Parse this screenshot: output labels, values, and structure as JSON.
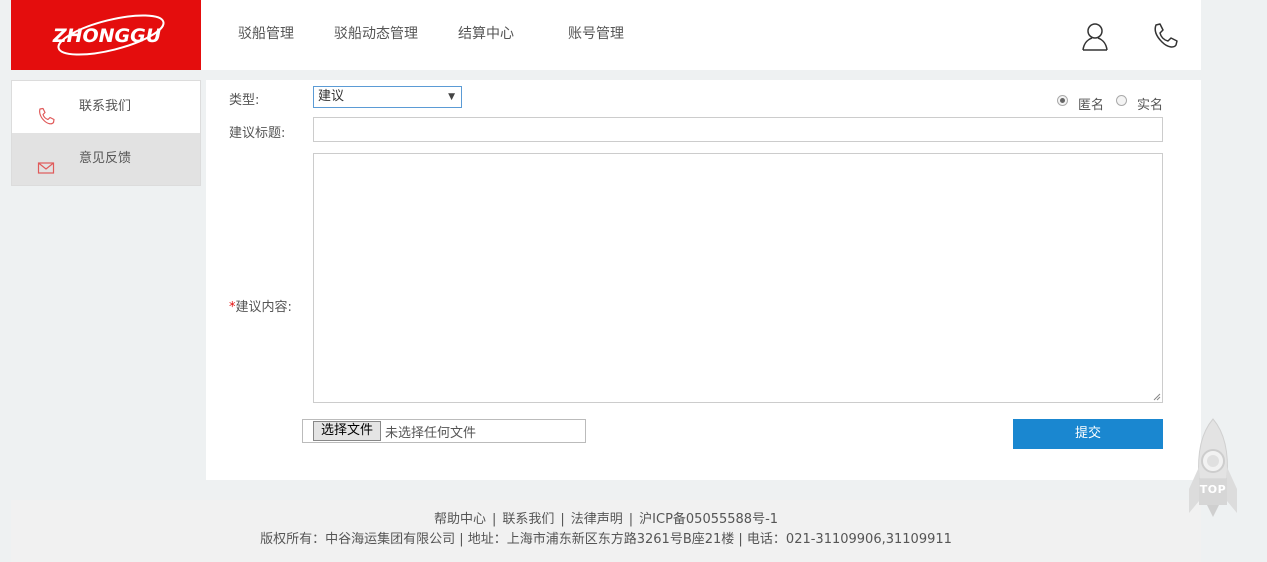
{
  "header": {
    "logo_text": "ZHONGGU",
    "nav": [
      "驳船管理",
      "驳船动态管理",
      "结算中心",
      "账号管理"
    ],
    "user_icon": "user-icon",
    "phone_icon": "phone-icon"
  },
  "sidebar": {
    "items": [
      {
        "label": "联系我们",
        "icon": "phone-icon",
        "active": false
      },
      {
        "label": "意见反馈",
        "icon": "mail-icon",
        "active": true
      }
    ]
  },
  "form": {
    "type_label": "类型:",
    "type_value": "建议",
    "anonymous_label": "匿名",
    "anonymous_checked": true,
    "realname_label": "实名",
    "title_label": "建议标题:",
    "title_value": "",
    "content_required_mark": "*",
    "content_label": "建议内容:",
    "content_value": "",
    "file_button": "选择文件",
    "file_status": "未选择任何文件",
    "submit_label": "提交"
  },
  "footer": {
    "links": [
      "帮助中心",
      "联系我们",
      "法律声明",
      "沪ICP备05055588号-1"
    ],
    "copyright": "版权所有：中谷海运集团有限公司 | 地址：上海市浦东新区东方路3261号B座21楼 | 电话：021-31109906,31109911"
  },
  "back_to_top": {
    "label": "TOP"
  },
  "colors": {
    "brand_red": "#e40d0d",
    "primary_blue": "#1a87d0",
    "page_bg": "#eef1f2"
  }
}
